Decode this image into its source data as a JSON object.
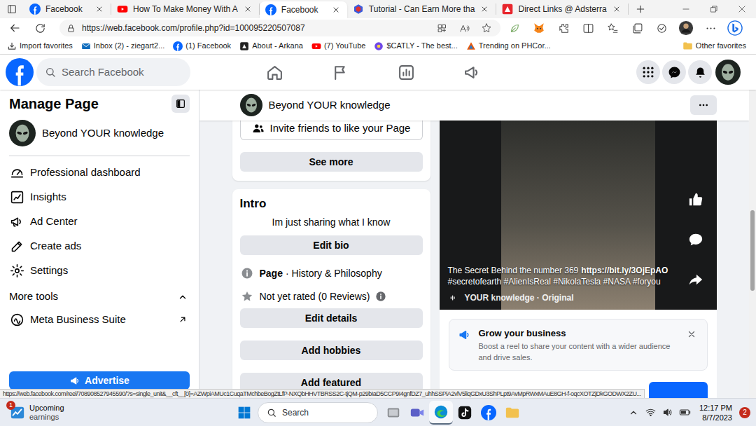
{
  "browser": {
    "tabs": [
      {
        "label": "Facebook",
        "kind": "facebook",
        "selected": false
      },
      {
        "label": "How To Make Money With A",
        "kind": "youtube",
        "selected": false
      },
      {
        "label": "Facebook",
        "kind": "facebook",
        "selected": true
      },
      {
        "label": "Tutorial - Can Earn More tha",
        "kind": "tutorial",
        "selected": false
      },
      {
        "label": "Direct Links @ Adsterra",
        "kind": "adsterra",
        "selected": false
      }
    ],
    "url": "https://web.facebook.com/profile.php?id=100095220507087",
    "favorites": [
      {
        "label": "Import favorites",
        "kind": "import"
      },
      {
        "label": "Inbox (2) - ziegart2...",
        "kind": "mail"
      },
      {
        "label": "(1) Facebook",
        "kind": "facebook"
      },
      {
        "label": "About - Arkana",
        "kind": "arkana"
      },
      {
        "label": "(7) YouTube",
        "kind": "youtube"
      },
      {
        "label": "$CATLY - The best...",
        "kind": "catly"
      },
      {
        "label": "Trending on PHCor...",
        "kind": "phcor"
      }
    ],
    "other_favorites": "Other favorites",
    "hover_link": "https://web.facebook.com/reel/708908527945590/?s=single_unit&__cft__[0]=AZWpiAMUc1CuqaTMchbeBogZtLfP-NXQbHHVTBRSS2C-tjQM-p29bIaD5CCP9I4gnfDZ7_uhhSSPiA2vlV5liqGDxU3ShPLpt9AvMpRWxMAuE8GH-f-oqcXOTZjDkGODWX2ZU..."
  },
  "facebook": {
    "search_placeholder": "Search Facebook",
    "sidebar": {
      "title": "Manage Page",
      "page_name": "Beyond YOUR knowledge",
      "items": [
        {
          "label": "Professional dashboard",
          "kind": "dashboard"
        },
        {
          "label": "Insights",
          "kind": "insights"
        },
        {
          "label": "Ad Center",
          "kind": "adcenter"
        },
        {
          "label": "Create ads",
          "kind": "create"
        },
        {
          "label": "Settings",
          "kind": "settings"
        }
      ],
      "more_tools": {
        "label": "More tools",
        "expanded": true,
        "items": [
          {
            "label": "Meta Business Suite",
            "kind": "business_suite"
          }
        ]
      },
      "advertise": "Advertise"
    },
    "page_header": {
      "name": "Beyond YOUR knowledge"
    },
    "invite": "Invite friends to like your Page",
    "see_more": "See more",
    "intro": {
      "title": "Intro",
      "bio": "Im just sharing what I know",
      "edit_bio": "Edit bio",
      "category_label": "Page",
      "category": "· History & Philosophy",
      "rating": "Not yet rated (0 Reviews)",
      "buttons": [
        "Edit details",
        "Add hobbies",
        "Add featured"
      ]
    },
    "reel": {
      "caption_title": "The Secret Behind the number 369",
      "caption_link": "https://bit.ly/3OjEpAO",
      "hashtags": "#secretofearth #AlienIsReal #NikolaTesla #NASA #foryou",
      "author": "YOUR knowledge · Original"
    },
    "boost": {
      "title": "Grow your business",
      "description": "Boost a reel to share your content with a wider audience and drive sales."
    }
  },
  "taskbar": {
    "widget": {
      "line1": "Upcoming",
      "line2": "earnings",
      "badge": "1"
    },
    "search": "Search",
    "apps": [
      {
        "kind": "explorer",
        "running": false
      },
      {
        "kind": "meet",
        "running": false
      },
      {
        "kind": "edge",
        "running": true
      },
      {
        "kind": "tiktok",
        "running": false
      },
      {
        "kind": "facebook",
        "running": false
      },
      {
        "kind": "folder",
        "running": false
      }
    ],
    "time": "12:17 PM",
    "date": "8/7/2023",
    "notifications": "2"
  }
}
